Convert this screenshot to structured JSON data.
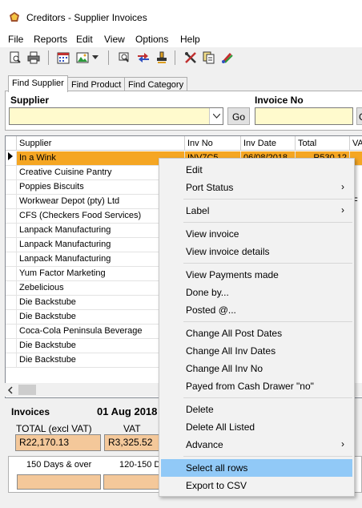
{
  "window": {
    "title": "Creditors - Supplier Invoices"
  },
  "menubar": [
    "File",
    "Reports",
    "Edit",
    "View",
    "Options",
    "Help"
  ],
  "tabs": [
    "Find Supplier",
    "Find Product",
    "Find Category"
  ],
  "search": {
    "supplier_label": "Supplier",
    "invoice_label": "Invoice No",
    "go_label": "Go",
    "go2_label": "G",
    "supplier_value": "",
    "invoice_value": ""
  },
  "grid": {
    "columns": [
      "Supplier",
      "Inv No",
      "Inv Date",
      "Total",
      "VA"
    ],
    "selected_row": {
      "supplier": "In a Wink",
      "inv_no": "INV7C5",
      "inv_date": "06/08/2018",
      "total": "R530.12"
    },
    "rows": [
      "In a Wink",
      "Creative Cuisine Pantry",
      "Poppies Biscuits",
      "Workwear Depot (pty) Ltd",
      "CFS (Checkers Food Services)",
      "Lanpack Manufacturing",
      "Lanpack Manufacturing",
      "Lanpack Manufacturing",
      "Yum Factor Marketing",
      "Zebelicious",
      "Die Backstube",
      "Die Backstube",
      "Coca-Cola Peninsula Beverage",
      "Die Backstube",
      "Die Backstube"
    ],
    "partial_va_4": "F"
  },
  "summary": {
    "invoices_label": "Invoices",
    "date": "01 Aug 2018",
    "total_label": "TOTAL (excl VAT)",
    "vat_label": "VAT",
    "total_value": "R22,170.13",
    "vat_value": "R3,325.52",
    "aging1_label": "150 Days & over",
    "aging2_label": "120-150 D"
  },
  "context_menu": {
    "items": [
      "Edit",
      "Port Status",
      "Label",
      "View invoice",
      "View invoice details",
      "View Payments made",
      "Done by...",
      "Posted @...",
      "Change All Post Dates",
      "Change All Inv Dates",
      "Change All Inv No",
      "Payed from Cash Drawer \"no\"",
      "Delete",
      "Delete All Listed",
      "Advance",
      "Select all rows",
      "Export to CSV"
    ],
    "highlighted": "Select all rows"
  },
  "colors": {
    "selected_row": "#f5a623",
    "field_yellow": "#fffacd",
    "summary_orange": "#f4c89a",
    "menu_highlight": "#91c9f7"
  }
}
